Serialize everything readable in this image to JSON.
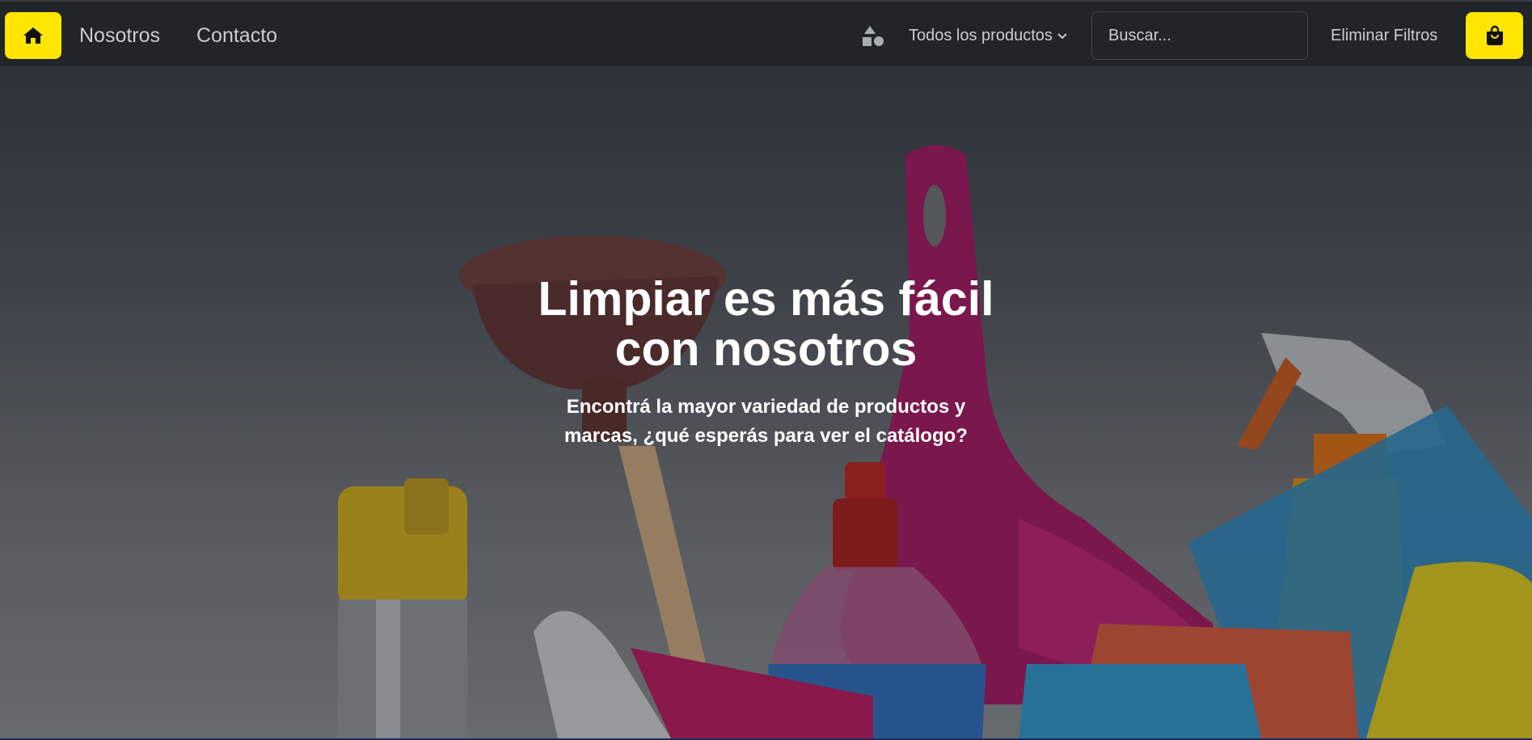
{
  "nav": {
    "home_icon": "home-icon",
    "links": [
      "Nosotros",
      "Contacto"
    ],
    "categories_icon": "shapes-icon",
    "products_label": "Todos los productos",
    "search_placeholder": "Buscar...",
    "clear_filters_label": "Eliminar Filtros",
    "cart_icon": "shopping-bag-icon"
  },
  "hero": {
    "title_line1": "Limpiar es más fácil",
    "title_line2": "con nosotros",
    "subtitle_line1": "Encontrá la mayor variedad de productos y",
    "subtitle_line2": "marcas, ¿qué esperás para ver el catálogo?"
  },
  "colors": {
    "navbar": "#212529",
    "accent": "#ffe500",
    "nav_text": "#c9ccd0",
    "hero_text": "#ffffff"
  }
}
